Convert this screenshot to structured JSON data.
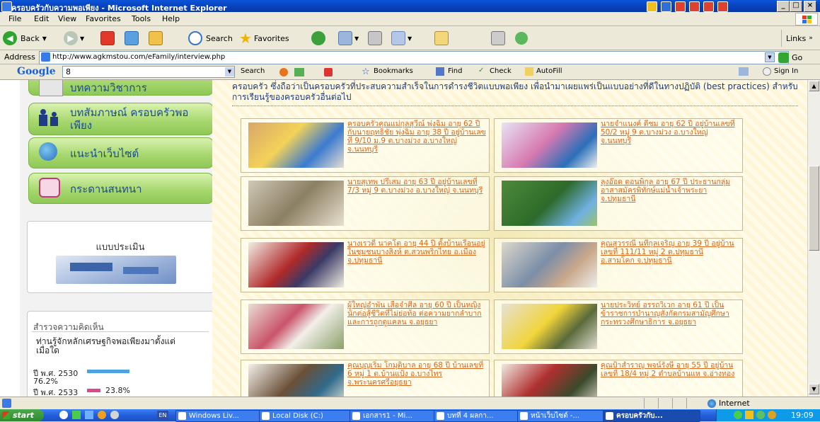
{
  "window": {
    "title": "ครอบครัวกับความพอเพียง - Microsoft Internet Explorer",
    "controls": [
      "_",
      "□",
      "×"
    ]
  },
  "menu": [
    "File",
    "Edit",
    "View",
    "Favorites",
    "Tools",
    "Help"
  ],
  "toolbar": {
    "back": "Back",
    "search": "Search",
    "favorites": "Favorites",
    "links": "Links"
  },
  "address": {
    "label": "Address",
    "url": "http://www.agkmstou.com/eFamily/interview.php",
    "go": "Go"
  },
  "google_bar": {
    "logo": "Google",
    "query": "8",
    "search": "Search",
    "bookmarks": "Bookmarks",
    "find": "Find",
    "check": "Check",
    "autofill": "AutoFill",
    "signin": "Sign In"
  },
  "sidebar": {
    "nav": [
      {
        "label": "บทความวิชาการ",
        "icon": "article-icon"
      },
      {
        "label": "บทสัมภาษณ์ ครอบครัวพอเพียง",
        "icon": "family-icon"
      },
      {
        "label": "แนะนำเว็บไซต์",
        "icon": "globe-icon"
      },
      {
        "label": "กระดานสนทนา",
        "icon": "chat-icon"
      }
    ],
    "assessment": "แบบประเมิน",
    "poll": {
      "title": "สำรวจความคิดเห็น",
      "question": "ท่านรู้จักหลักเศรษฐกิจพอเพียงมาตั้งแต่เมื่อใด",
      "options": [
        {
          "label": "ปี พ.ศ. 2530",
          "percent": "76.2%",
          "value": 76.2,
          "color": "#4aa3df"
        },
        {
          "label": "ปี พ.ศ. 2533",
          "percent": "23.8%",
          "value": 23.8,
          "color": "#e0468c"
        }
      ]
    }
  },
  "main": {
    "intro": "ครอบครัว ซึ่งถือว่าเป็นครอบครัวที่ประสบความสำเร็จในการดำรงชีวิตแบบพอเพียง เพื่อนำมาเผยแพร่เป็นแบบอย่างที่ดีในทางปฏิบัติ (best practices) สำหรับการเรียนรู้ของครอบครัวอื่นต่อไป",
    "interviews": [
      "ครอบครัวคุณแม่กุลสุวีณ์ พุ่งฉิม อายุ 62 ปี กับนายฤทธิชัย พุ่งฉิม อายุ 38 ปี อยู่บ้านเลขที่ 9/10 ม.9 ต.บางม่วง อ.บางใหญ่ จ.นนทบุรี",
      "นายจำแนงค์ ดีชม อายุ 62 ปี อยู่บ้านเลขที่ 50/2 หมู่ 9 ต.บางม่วง อ.บางใหญ่ จ.นนทบุรี",
      "นายสุเทพ ปรีเสม อายุ 63 ปี อยู่บ้านเลขที่ 7/3 หมู่ 9 ต.บางม่วง อ.บางใหญ่ จ.นนทบุรี",
      "ลุงอ๊อด ดอนพิกุล อายุ 67 ปี ประธานกลุ่มอาสาสมัครพิทักษ์แม่น้ำเจ้าพระยา จ.ปทุมธานี",
      "นางเรวดี นาคโต อายุ 44 ปี ตั้งบ้านเรือนอยู่ในชุมชนบางสิงห์ ต.สวนพริกไทย อ.เมือง จ.ปทุมธานี",
      "คุณสุวรรณี นทีกุลเจริญ อายุ 39 ปี อยู่บ้านเลขที่ 111/11 หมู่ 2 ต.ปทุมธานี อ.สามโคก จ.ปทุมธานี",
      "ผู้ใหญ่อำพัน เสือจำศีล อายุ 60 ปี เป็นหญิงนักต่อสู้ชีวิตที่ไม่ย่อท้อ ต่อความยากลำบาก และการถูกดูแคลน จ.อยุธยา",
      "นายประวิทย์ อรรถวิเวก อายุ 61 ปี เป็นข้าราชการบำนาญสังกัดกรมสามัญศึกษา กระทรวงศึกษาธิการ จ.อยุธยา",
      "คุณบุญเริ่ม โกมุติบาล อายุ 68 ปี บ้านเลขที่ 6 หมู่ 1 ต.บ้านแป้ง อ.บางไทร จ.พระนครศรีอยุธยา",
      "คุณป้าสำราญ พจน์รังษี อายุ 55 ปี อยู่บ้านเลขที่ 18/4 หมู่ 2 ตำบลบ้านแห จ.อ่างทอง"
    ]
  },
  "status": {
    "zone": "Internet"
  },
  "taskbar": {
    "start": "start",
    "lang": "EN",
    "tasks": [
      "Windows Liv...",
      "Local Disk (C:)",
      "เอกสาร1 - Mi...",
      "บทที่ 4 ผลกา...",
      "หน้าเว็บไซต์ -...",
      "ครอบครัวกับ..."
    ],
    "clock": "19:09"
  }
}
